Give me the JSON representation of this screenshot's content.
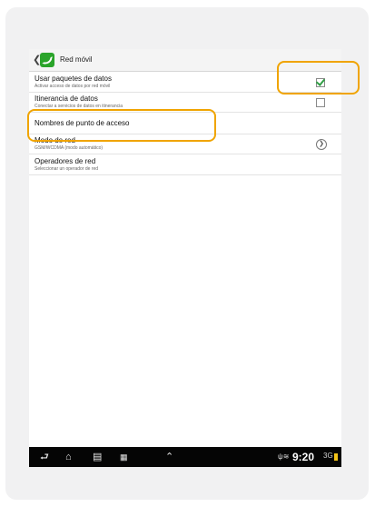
{
  "action_bar": {
    "title": "Red móvil"
  },
  "settings": [
    {
      "title": "Usar paquetes de datos",
      "subtitle": "Activar acceso de datos por red móvil",
      "control": "checkbox",
      "checked": true
    },
    {
      "title": "Itinerancia de datos",
      "subtitle": "Conectar a servicios de datos en itinerancia",
      "control": "checkbox",
      "checked": false
    },
    {
      "title": "Nombres de punto de acceso",
      "subtitle": "",
      "control": "none"
    },
    {
      "title": "Modo de red",
      "subtitle": "GSM/WCDMA (modo automático)",
      "control": "chevron"
    },
    {
      "title": "Operadores de red",
      "subtitle": "Seleccionar un operador de red",
      "control": "none"
    }
  ],
  "status_bar": {
    "time": "9:20",
    "signal_label": "3G"
  },
  "icons": {
    "back": "chevron-left-icon",
    "app": "phone-app-icon",
    "nav_back": "back-icon",
    "nav_home": "home-icon",
    "nav_recent": "recent-apps-icon",
    "nav_screenshot": "screenshot-icon",
    "nav_up": "chevron-up-icon"
  },
  "colors": {
    "highlight": "#f0a400",
    "app_icon": "#2aa42a",
    "check": "#2f9e44"
  }
}
